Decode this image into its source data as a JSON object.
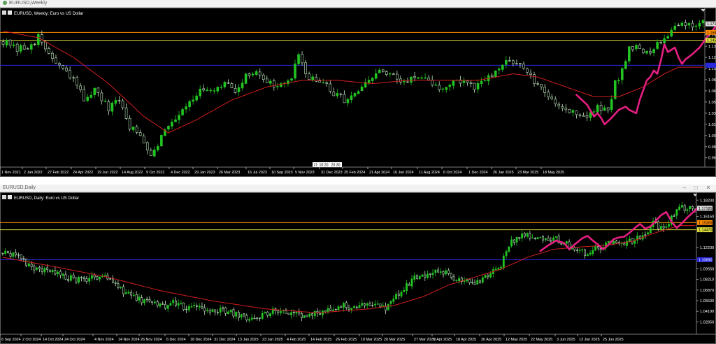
{
  "colors": {
    "background": "#000000",
    "bull": "#22c322",
    "bear": "#bfe6bf",
    "ma": "#d21e1e",
    "pattern": "#e61e82",
    "line_orange": "#ff8c00",
    "line_yellow": "#dcdc3c",
    "line_blue": "#2828dc"
  },
  "windows": [
    {
      "title": "EURUSD,Weekly",
      "header": "EURUSD, Weekly:  Euro vs US Dollar",
      "controls": [
        "–",
        "□",
        "✕"
      ],
      "chart_data": {
        "type": "candlestick",
        "symbol": "EURUSD",
        "timeframe": "Weekly",
        "description": "Euro vs US Dollar",
        "xlabel": "",
        "ylabel": "",
        "ylim": [
          0.955,
          1.185
        ],
        "price_ticks": [
          "1.154",
          "1.137",
          "1.120",
          "1.103",
          "1.086",
          "1.069",
          "1.052",
          "1.035",
          "1.018",
          "1.001",
          "0.984",
          "0.967"
        ],
        "date_ticks": [
          "1 Nov 2021",
          "2 Jan 2022",
          "27 Feb 2022",
          "24 Apr 2022",
          "19 Jun 2022",
          "14 Aug 2022",
          "9 Oct 2022",
          "4 Dec 2022",
          "29 Jan 2023",
          "26 Mar 2023",
          "16 Jul 2023",
          "10 Sep 2023",
          "5 Nov 2023",
          "31 Dec 2023",
          "25 Feb 2024",
          "21 Apr 2024",
          "16 Jun 2024",
          "11 Aug 2024",
          "6 Oct 2024",
          "1 Dec 2024",
          "26 Jan 2025",
          "23 Mar 2025",
          "18 May 2025"
        ],
        "crosshair_tags": [
          "21",
          "10:20",
          "20:30"
        ],
        "price_labels": [
          {
            "value": 1.171,
            "label": "1.171",
            "kind": "current"
          },
          {
            "value": 1.158,
            "label": "1.158",
            "kind": "orange"
          },
          {
            "value": 1.146,
            "label": "1.145",
            "kind": "yellow"
          },
          {
            "value": 1.108,
            "label": "",
            "kind": "blue"
          }
        ],
        "levels": [
          {
            "value": 1.158,
            "color": "#ff8c00"
          },
          {
            "value": 1.146,
            "color": "#dcdc3c"
          },
          {
            "value": 1.108,
            "color": "#2828dc"
          }
        ],
        "close_path": [
          [
            0,
            1.145
          ],
          [
            4,
            1.13
          ],
          [
            8,
            1.14
          ],
          [
            10,
            1.15
          ],
          [
            13,
            1.125
          ],
          [
            17,
            1.1
          ],
          [
            20,
            1.085
          ],
          [
            23,
            1.058
          ],
          [
            26,
            1.07
          ],
          [
            30,
            1.04
          ],
          [
            33,
            1.055
          ],
          [
            36,
            1.015
          ],
          [
            39,
            1.0
          ],
          [
            42,
            0.975
          ],
          [
            44,
            0.99
          ],
          [
            47,
            1.018
          ],
          [
            50,
            1.035
          ],
          [
            53,
            1.055
          ],
          [
            56,
            1.068
          ],
          [
            60,
            1.065
          ],
          [
            63,
            1.08
          ],
          [
            66,
            1.07
          ],
          [
            69,
            1.09
          ],
          [
            72,
            1.1
          ],
          [
            76,
            1.08
          ],
          [
            79,
            1.075
          ],
          [
            82,
            1.09
          ],
          [
            84,
            1.12
          ],
          [
            86,
            1.095
          ],
          [
            89,
            1.085
          ],
          [
            92,
            1.075
          ],
          [
            95,
            1.06
          ],
          [
            98,
            1.055
          ],
          [
            101,
            1.068
          ],
          [
            104,
            1.082
          ],
          [
            107,
            1.1
          ],
          [
            110,
            1.092
          ],
          [
            113,
            1.082
          ],
          [
            116,
            1.09
          ],
          [
            119,
            1.085
          ],
          [
            122,
            1.08
          ],
          [
            125,
            1.07
          ],
          [
            128,
            1.085
          ],
          [
            131,
            1.082
          ],
          [
            134,
            1.072
          ],
          [
            137,
            1.085
          ],
          [
            140,
            1.095
          ],
          [
            143,
            1.112
          ],
          [
            146,
            1.115
          ],
          [
            148,
            1.1
          ],
          [
            150,
            1.09
          ],
          [
            152,
            1.075
          ],
          [
            155,
            1.06
          ],
          [
            158,
            1.05
          ],
          [
            160,
            1.04
          ],
          [
            163,
            1.035
          ],
          [
            166,
            1.03
          ],
          [
            169,
            1.042
          ],
          [
            172,
            1.04
          ],
          [
            174,
            1.08
          ],
          [
            176,
            1.1
          ],
          [
            178,
            1.135
          ],
          [
            180,
            1.14
          ],
          [
            182,
            1.125
          ],
          [
            184,
            1.125
          ],
          [
            186,
            1.14
          ],
          [
            188,
            1.15
          ],
          [
            190,
            1.165
          ],
          [
            192,
            1.171
          ]
        ],
        "ma_path": [
          [
            0,
            1.16
          ],
          [
            10,
            1.15
          ],
          [
            20,
            1.12
          ],
          [
            30,
            1.08
          ],
          [
            40,
            1.03
          ],
          [
            47,
            1.005
          ],
          [
            55,
            1.025
          ],
          [
            65,
            1.055
          ],
          [
            75,
            1.075
          ],
          [
            85,
            1.085
          ],
          [
            95,
            1.085
          ],
          [
            105,
            1.08
          ],
          [
            115,
            1.085
          ],
          [
            125,
            1.085
          ],
          [
            135,
            1.085
          ],
          [
            145,
            1.095
          ],
          [
            152,
            1.09
          ],
          [
            160,
            1.075
          ],
          [
            168,
            1.06
          ],
          [
            175,
            1.06
          ],
          [
            182,
            1.075
          ],
          [
            188,
            1.095
          ],
          [
            192,
            1.105
          ]
        ],
        "pattern_path": [
          [
            163,
            1.063
          ],
          [
            166,
            1.048
          ],
          [
            168,
            1.03
          ],
          [
            169,
            1.035
          ],
          [
            170,
            1.028
          ],
          [
            171,
            1.018
          ],
          [
            173,
            1.028
          ],
          [
            175,
            1.04
          ],
          [
            177,
            1.045
          ],
          [
            178,
            1.04
          ],
          [
            180,
            1.035
          ],
          [
            181,
            1.055
          ],
          [
            183,
            1.085
          ],
          [
            184,
            1.09
          ],
          [
            185,
            1.1
          ],
          [
            186,
            1.095
          ],
          [
            187,
            1.115
          ],
          [
            188,
            1.14
          ],
          [
            189,
            1.128
          ],
          [
            191,
            1.135
          ],
          [
            192,
            1.12
          ],
          [
            193,
            1.11
          ],
          [
            194,
            1.117
          ],
          [
            196,
            1.125
          ],
          [
            198,
            1.135
          ],
          [
            200,
            1.15
          ],
          [
            202,
            1.163
          ],
          [
            203,
            1.171
          ]
        ],
        "bar_count": 200
      }
    },
    {
      "title": "EURUSD,Daily",
      "header": "EURUSD, Daily:  Euro vs US Dollar",
      "controls": [
        "–",
        "□",
        "✕"
      ],
      "chart_data": {
        "type": "candlestick",
        "symbol": "EURUSD",
        "timeframe": "Daily",
        "description": "Euro vs US Dollar",
        "xlabel": "",
        "ylabel": "",
        "ylim": [
          1.013,
          1.184
        ],
        "price_ticks": [
          "1.18200",
          "1.16150",
          "1.12230",
          "1.09550",
          "1.08210",
          "1.06870",
          "1.05530",
          "1.04190",
          "1.02850"
        ],
        "date_ticks": [
          "6 Sep 2024",
          "2 Oct 2024",
          "14 Oct 2024",
          "24 Oct 2024",
          "4 Nov 2024",
          "14 Nov 2024",
          "26 Nov 2024",
          "6 Dec 2024",
          "18 Dec 2024",
          "31 Dec 2024",
          "13 Jan 2025",
          "23 Jan 2025",
          "4 Feb 2025",
          "14 Feb 2025",
          "26 Feb 2025",
          "10 Mar 2025",
          "20 Mar 2025",
          "27 Mar 2025",
          "8 Apr 2025",
          "18 Apr 2025",
          "30 Apr 2025",
          "12 May 2025",
          "22 May 2025",
          "3 Jun 2025",
          "13 Jun 2025",
          "25 Jun 2025"
        ],
        "price_labels": [
          {
            "value": 1.1718,
            "label": "1.17185",
            "kind": "current"
          },
          {
            "value": 1.1537,
            "label": "1.15369",
            "kind": "orange"
          },
          {
            "value": 1.1447,
            "label": "1.14470",
            "kind": "yellow"
          },
          {
            "value": 1.1069,
            "label": "1.10690",
            "kind": "blue"
          }
        ],
        "levels": [
          {
            "value": 1.1537,
            "color": "#ff8c00"
          },
          {
            "value": 1.1447,
            "color": "#dcdc3c"
          },
          {
            "value": 1.1069,
            "color": "#2828dc"
          }
        ],
        "close_path": [
          [
            0,
            1.115
          ],
          [
            6,
            1.11
          ],
          [
            10,
            1.1
          ],
          [
            14,
            1.095
          ],
          [
            18,
            1.092
          ],
          [
            22,
            1.088
          ],
          [
            26,
            1.083
          ],
          [
            30,
            1.08
          ],
          [
            34,
            1.085
          ],
          [
            38,
            1.087
          ],
          [
            42,
            1.08
          ],
          [
            46,
            1.068
          ],
          [
            50,
            1.058
          ],
          [
            54,
            1.055
          ],
          [
            58,
            1.05
          ],
          [
            62,
            1.048
          ],
          [
            66,
            1.053
          ],
          [
            70,
            1.046
          ],
          [
            74,
            1.05
          ],
          [
            78,
            1.045
          ],
          [
            82,
            1.044
          ],
          [
            86,
            1.04
          ],
          [
            90,
            1.038
          ],
          [
            94,
            1.033
          ],
          [
            98,
            1.035
          ],
          [
            102,
            1.04
          ],
          [
            106,
            1.045
          ],
          [
            110,
            1.04
          ],
          [
            114,
            1.035
          ],
          [
            118,
            1.038
          ],
          [
            122,
            1.04
          ],
          [
            126,
            1.045
          ],
          [
            130,
            1.048
          ],
          [
            134,
            1.046
          ],
          [
            138,
            1.05
          ],
          [
            142,
            1.05
          ],
          [
            146,
            1.045
          ],
          [
            150,
            1.06
          ],
          [
            154,
            1.075
          ],
          [
            158,
            1.085
          ],
          [
            162,
            1.088
          ],
          [
            166,
            1.092
          ],
          [
            170,
            1.088
          ],
          [
            174,
            1.082
          ],
          [
            178,
            1.078
          ],
          [
            182,
            1.08
          ],
          [
            186,
            1.09
          ],
          [
            190,
            1.1
          ],
          [
            194,
            1.13
          ],
          [
            198,
            1.14
          ],
          [
            202,
            1.135
          ],
          [
            206,
            1.13
          ],
          [
            210,
            1.135
          ],
          [
            214,
            1.128
          ],
          [
            218,
            1.12
          ],
          [
            222,
            1.115
          ],
          [
            226,
            1.12
          ],
          [
            230,
            1.125
          ],
          [
            234,
            1.13
          ],
          [
            238,
            1.128
          ],
          [
            242,
            1.135
          ],
          [
            246,
            1.14
          ],
          [
            248,
            1.155
          ],
          [
            250,
            1.148
          ],
          [
            252,
            1.15
          ],
          [
            254,
            1.155
          ],
          [
            256,
            1.163
          ],
          [
            258,
            1.172
          ]
        ],
        "ma_path": [
          [
            0,
            1.11
          ],
          [
            20,
            1.098
          ],
          [
            40,
            1.085
          ],
          [
            60,
            1.068
          ],
          [
            80,
            1.055
          ],
          [
            100,
            1.045
          ],
          [
            120,
            1.04
          ],
          [
            140,
            1.045
          ],
          [
            150,
            1.05
          ],
          [
            160,
            1.06
          ],
          [
            170,
            1.075
          ],
          [
            180,
            1.085
          ],
          [
            190,
            1.095
          ],
          [
            200,
            1.11
          ],
          [
            210,
            1.12
          ],
          [
            220,
            1.123
          ],
          [
            230,
            1.125
          ],
          [
            240,
            1.13
          ],
          [
            248,
            1.14
          ],
          [
            258,
            1.15
          ]
        ],
        "pattern_path": [
          [
            205,
            1.118
          ],
          [
            208,
            1.125
          ],
          [
            211,
            1.131
          ],
          [
            214,
            1.128
          ],
          [
            216,
            1.12
          ],
          [
            218,
            1.126
          ],
          [
            221,
            1.134
          ],
          [
            223,
            1.137
          ],
          [
            225,
            1.131
          ],
          [
            227,
            1.126
          ],
          [
            229,
            1.12
          ],
          [
            231,
            1.126
          ],
          [
            233,
            1.133
          ],
          [
            235,
            1.135
          ],
          [
            237,
            1.136
          ],
          [
            239,
            1.141
          ],
          [
            241,
            1.147
          ],
          [
            243,
            1.152
          ],
          [
            245,
            1.146
          ],
          [
            247,
            1.149
          ],
          [
            249,
            1.156
          ],
          [
            251,
            1.163
          ],
          [
            253,
            1.167
          ],
          [
            255,
            1.155
          ],
          [
            257,
            1.147
          ],
          [
            259,
            1.153
          ],
          [
            261,
            1.16
          ],
          [
            263,
            1.166
          ],
          [
            265,
            1.172
          ]
        ],
        "bar_count": 265
      }
    }
  ]
}
